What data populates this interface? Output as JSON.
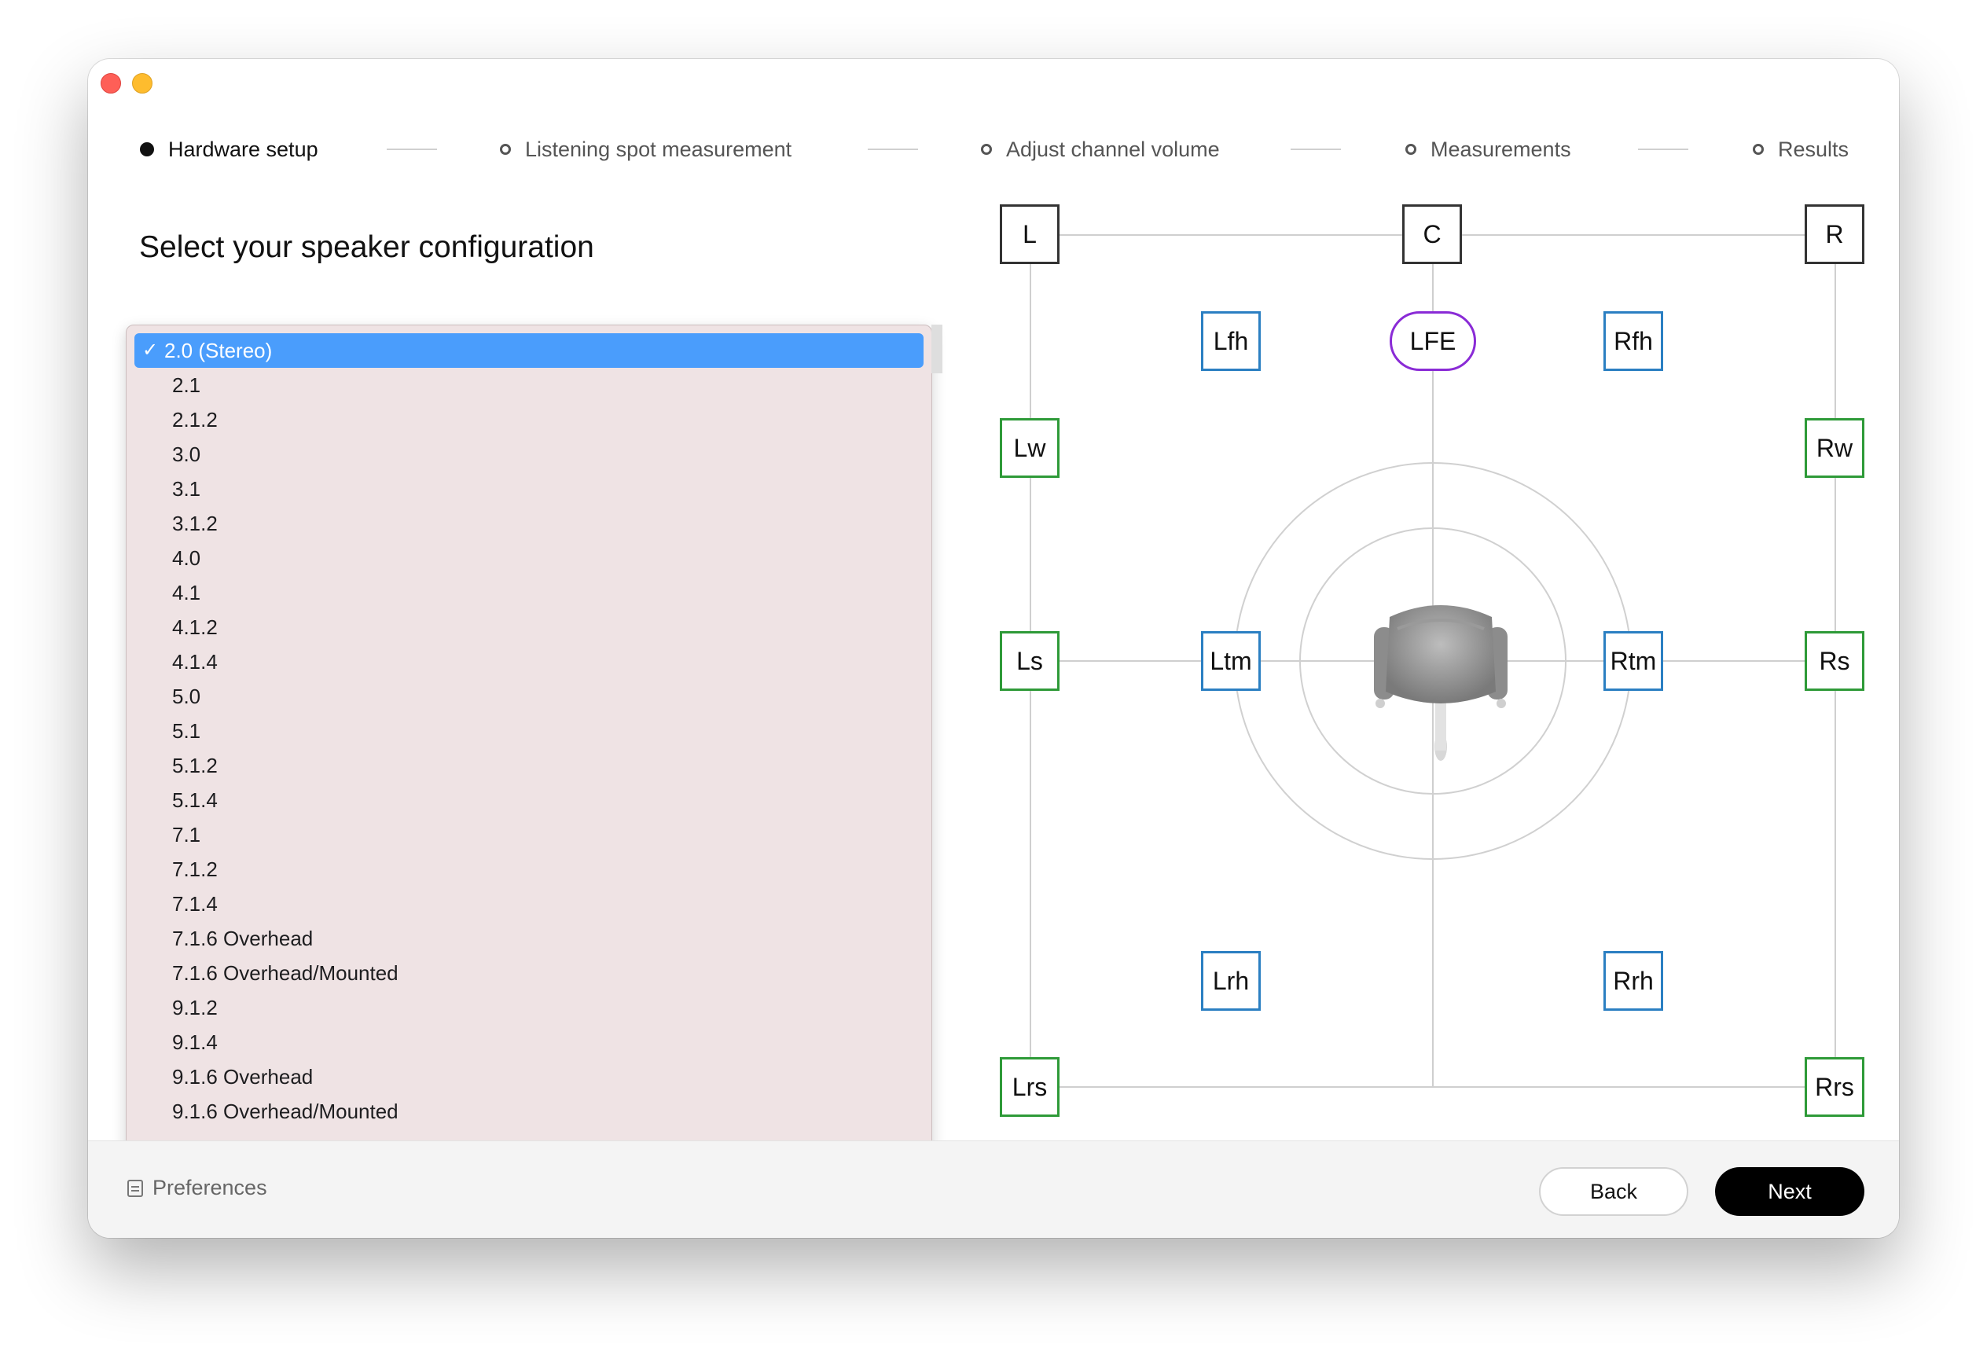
{
  "window": {
    "controls": [
      "close",
      "minimize"
    ]
  },
  "stepper": {
    "steps": [
      {
        "label": "Hardware setup",
        "state": "active"
      },
      {
        "label": "Listening spot measurement",
        "state": "pending"
      },
      {
        "label": "Adjust channel volume",
        "state": "pending"
      },
      {
        "label": "Measurements",
        "state": "pending"
      },
      {
        "label": "Results",
        "state": "pending"
      }
    ]
  },
  "main": {
    "heading": "Select your speaker configuration",
    "dropdown": {
      "selected": "2.0 (Stereo)",
      "check_glyph": "✓",
      "options": [
        "2.0 (Stereo)",
        "2.1",
        "2.1.2",
        "3.0",
        "3.1",
        "3.1.2",
        "4.0",
        "4.1",
        "4.1.2",
        "4.1.4",
        "5.0",
        "5.1",
        "5.1.2",
        "5.1.4",
        "7.1",
        "7.1.2",
        "7.1.4",
        "7.1.6 Overhead",
        "7.1.6 Overhead/Mounted",
        "9.1.2",
        "9.1.4",
        "9.1.6 Overhead",
        "9.1.6 Overhead/Mounted"
      ]
    }
  },
  "speakers": {
    "L": "L",
    "C": "C",
    "R": "R",
    "Lfh": "Lfh",
    "LFE": "LFE",
    "Rfh": "Rfh",
    "Lw": "Lw",
    "Rw": "Rw",
    "Ls": "Ls",
    "Ltm": "Ltm",
    "Rtm": "Rtm",
    "Rs": "Rs",
    "Lrh": "Lrh",
    "Rrh": "Rrh",
    "Lrs": "Lrs",
    "Rrs": "Rrs"
  },
  "colors": {
    "front": "#333333",
    "height": "#2b7fc2",
    "surround": "#2e9a38",
    "lfe": "#8a2bd6",
    "selection": "#4a9dfc"
  },
  "footer": {
    "preferences_label": "Preferences",
    "preferences_icon": "document-icon",
    "back_label": "Back",
    "next_label": "Next"
  }
}
